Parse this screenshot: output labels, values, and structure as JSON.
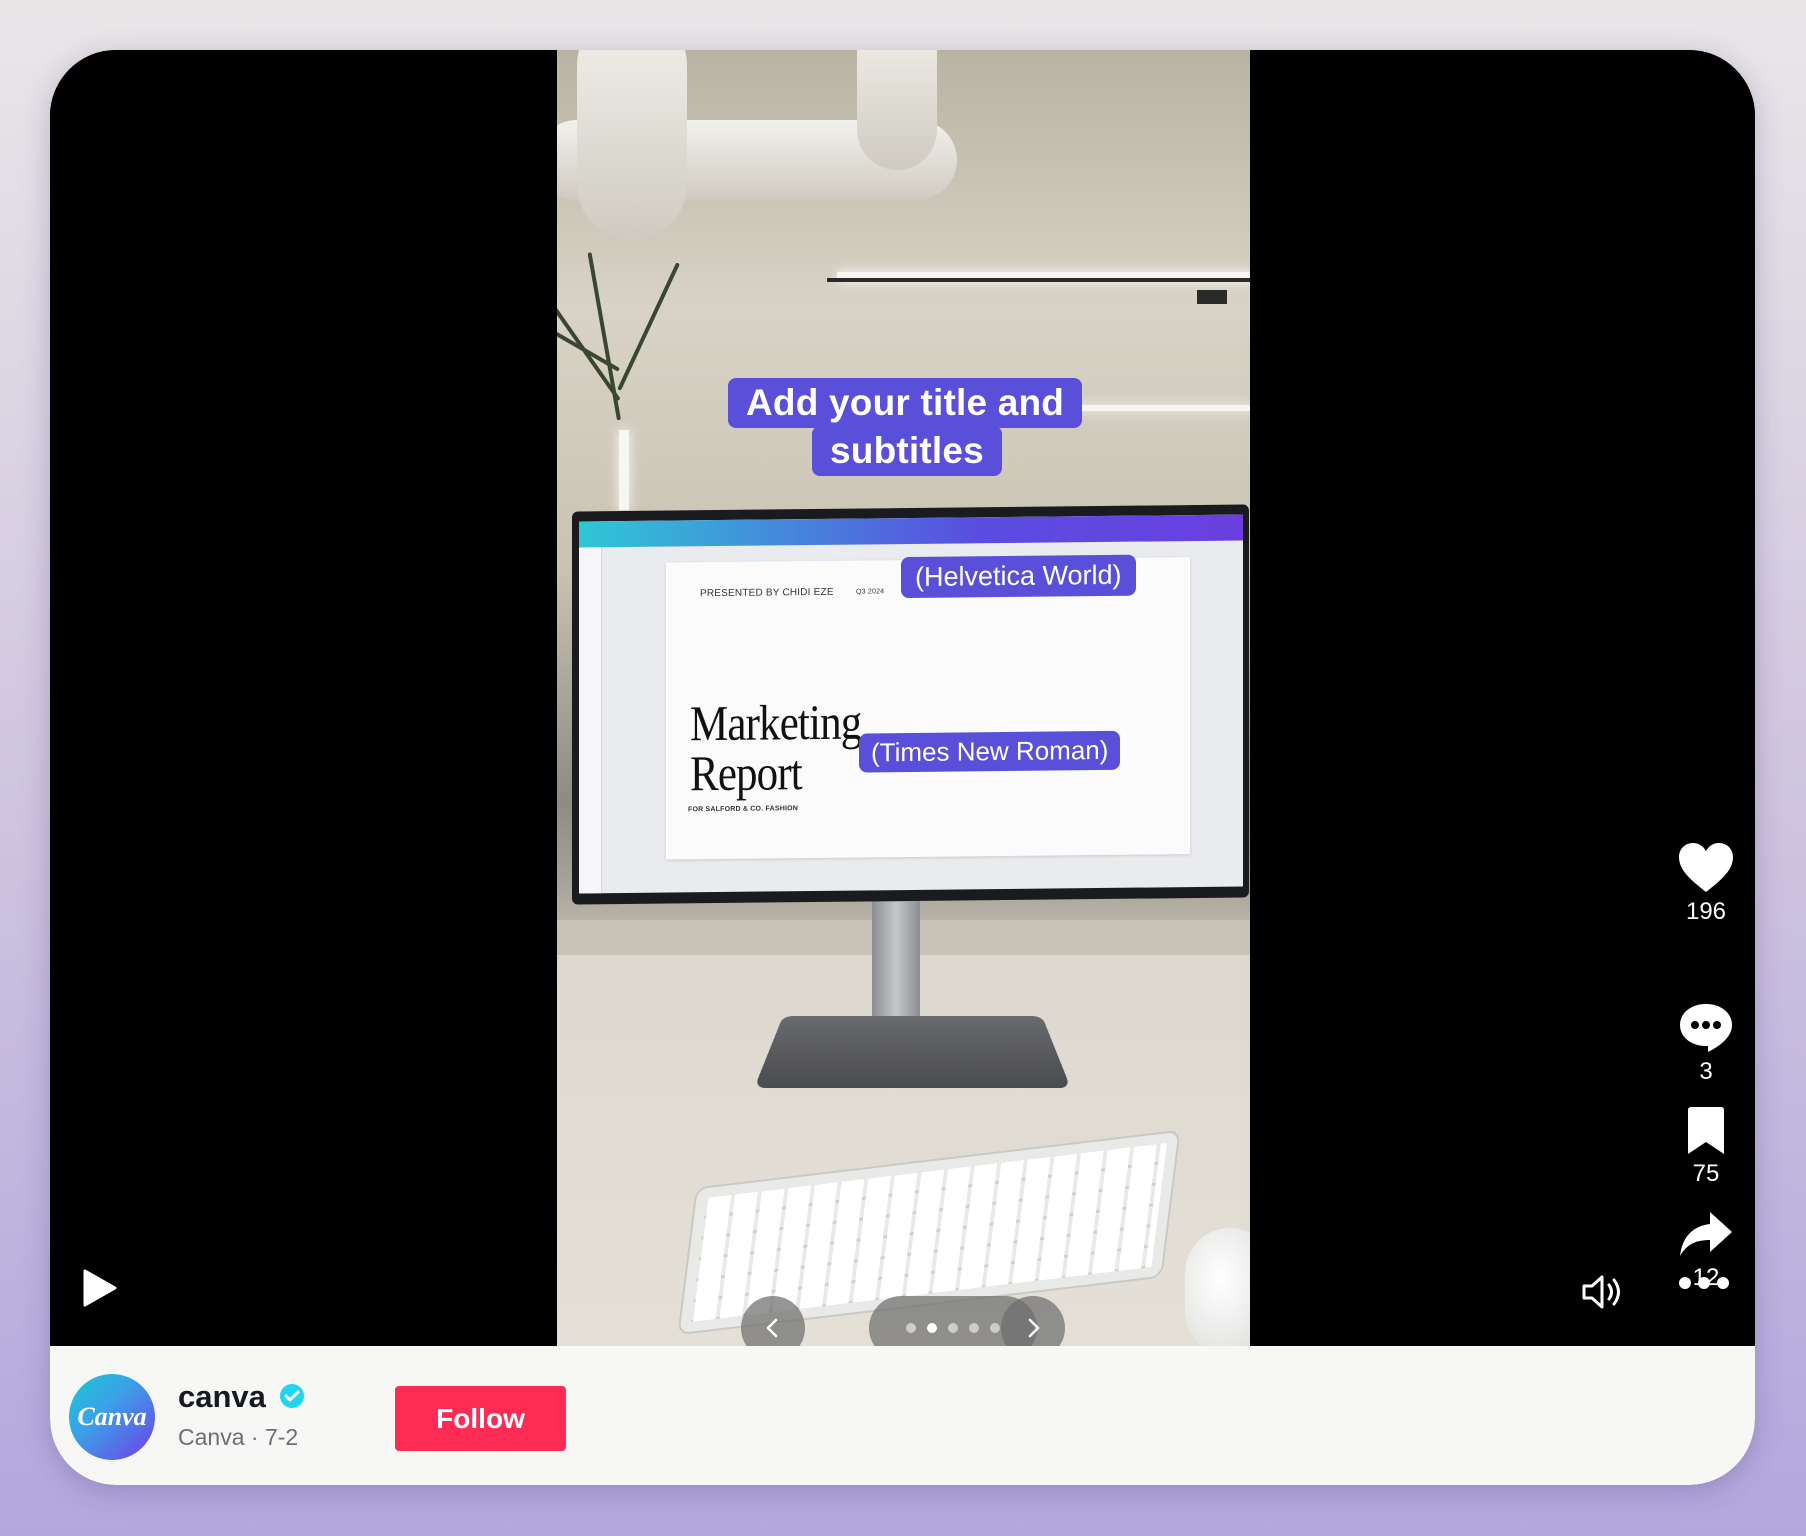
{
  "video": {
    "caption_line1": "Add your title and",
    "caption_line2": "subtitles",
    "slide": {
      "presenter": "PRESENTED BY CHIDI EZE",
      "quarter": "Q3 2024",
      "title": "Marketing\nReport",
      "subtitle": "FOR SALFORD & CO. FASHION"
    },
    "label_helvetica": "(Helvetica World)",
    "label_times": "(Times New Roman)"
  },
  "carousel": {
    "dot_count": 5,
    "active_index": 1
  },
  "actions": {
    "likes": "196",
    "comments": "3",
    "saves": "75",
    "shares": "12"
  },
  "author": {
    "avatar_text": "Canva",
    "username": "canva",
    "display_name": "Canva",
    "separator": "·",
    "date": "7-2",
    "follow_label": "Follow",
    "verified": true
  },
  "colors": {
    "label_bg": "#5a4fd9",
    "follow_bg": "#fe2c55",
    "verified": "#20d5ec"
  }
}
